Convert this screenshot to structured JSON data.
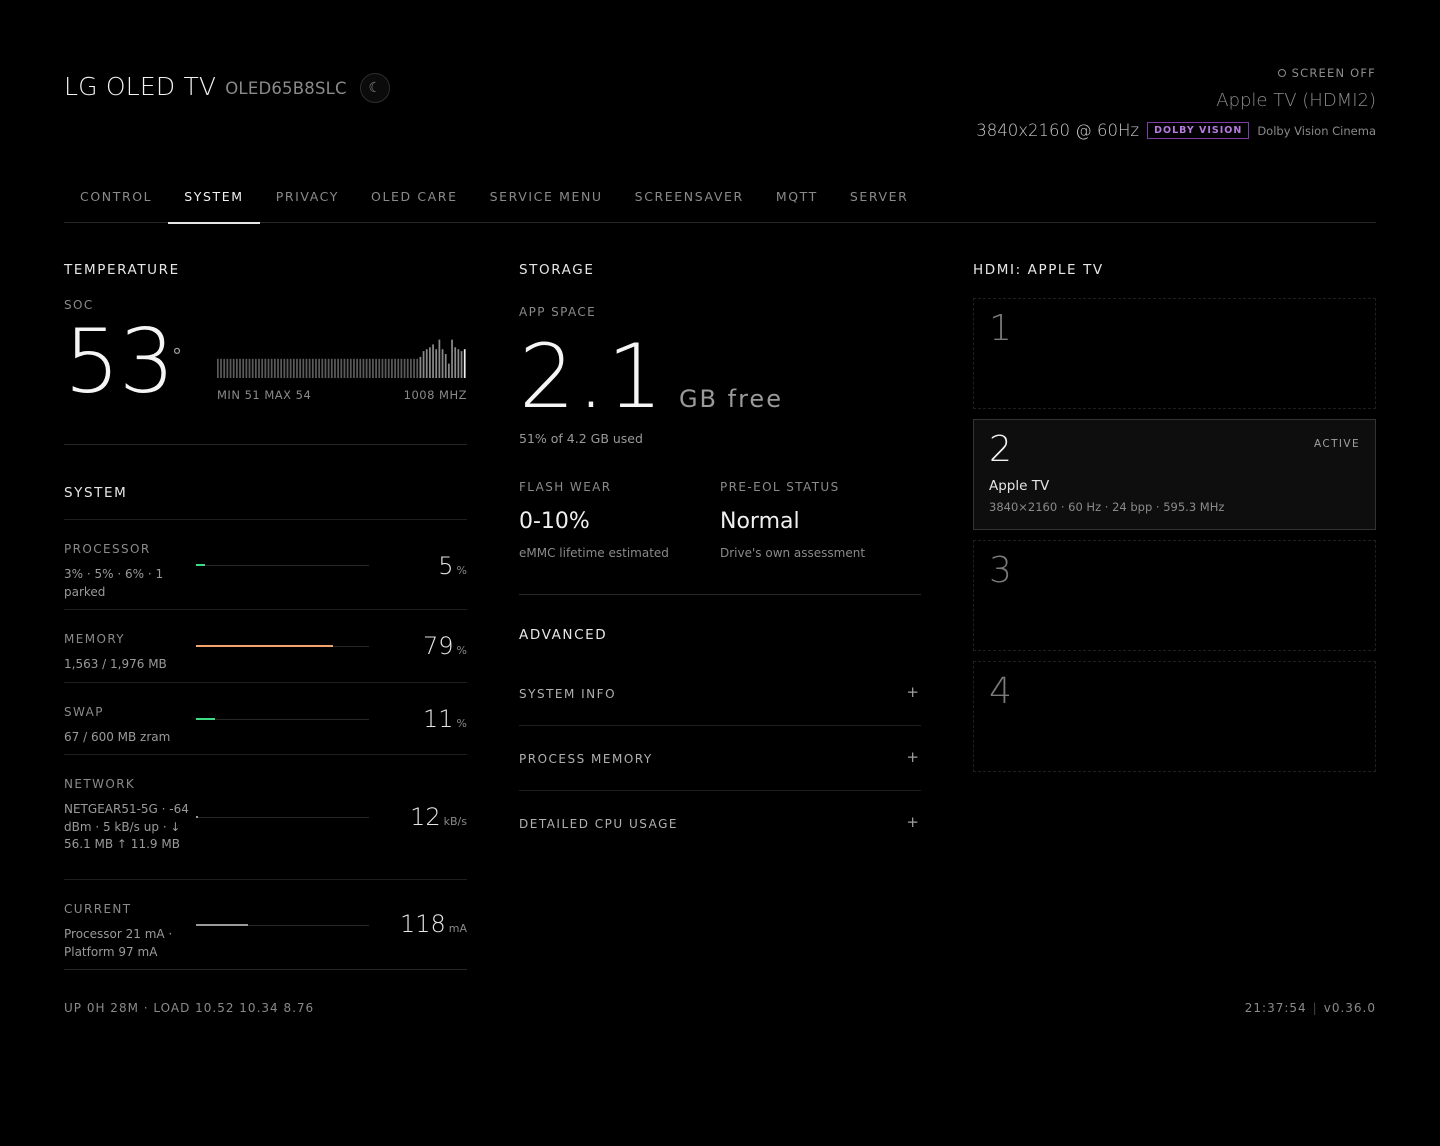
{
  "header": {
    "title": "LG OLED TV",
    "model": "OLED65B8SLC",
    "theme_icon": "moon-icon",
    "screen_off_label": "SCREEN OFF",
    "input_name": "Apple TV (HDMI2)",
    "resolution": "3840x2160 @ 60Hz",
    "hdr_badge": "DOLBY VISION",
    "picture_mode": "Dolby Vision Cinema"
  },
  "tabs": [
    {
      "label": "CONTROL",
      "active": false
    },
    {
      "label": "SYSTEM",
      "active": true
    },
    {
      "label": "PRIVACY",
      "active": false
    },
    {
      "label": "OLED CARE",
      "active": false
    },
    {
      "label": "SERVICE MENU",
      "active": false
    },
    {
      "label": "SCREENSAVER",
      "active": false
    },
    {
      "label": "MQTT",
      "active": false
    },
    {
      "label": "SERVER",
      "active": false
    }
  ],
  "temperature": {
    "title": "TEMPERATURE",
    "sensor_label": "SOC",
    "value": "53",
    "degree": "°",
    "min_max": "MIN 51 MAX 54",
    "frequency": "1008 MHZ",
    "history_scale": [
      50,
      55
    ],
    "history": [
      52,
      52,
      52,
      52,
      52,
      52,
      52,
      52,
      52,
      52,
      52,
      52,
      52,
      52,
      52,
      52,
      52,
      52,
      52,
      52,
      52,
      52,
      52,
      52,
      52,
      52,
      52,
      52,
      52,
      52,
      52,
      52,
      52,
      52,
      52,
      52,
      52,
      52,
      52,
      52,
      52,
      52,
      52,
      52,
      52,
      52,
      52,
      52,
      52,
      52,
      52,
      52,
      52,
      52,
      52,
      52,
      52,
      52,
      52,
      52,
      52,
      52,
      52,
      52,
      52.2,
      52.8,
      53,
      53.2,
      53.5,
      53,
      54,
      53,
      52.5,
      51.5,
      54,
      53.2,
      53,
      52.8,
      53
    ]
  },
  "system": {
    "title": "SYSTEM",
    "rows": [
      {
        "label": "PROCESSOR",
        "desc": "3% · 5% · 6% · 1 parked",
        "value": "5",
        "unit": "%",
        "fill_pct": 5,
        "color": "#3ddc84"
      },
      {
        "label": "MEMORY",
        "desc": "1,563 / 1,976 MB",
        "value": "79",
        "unit": "%",
        "fill_pct": 79,
        "color": "#f5a36c"
      },
      {
        "label": "SWAP",
        "desc": "67 / 600 MB zram",
        "value": "11",
        "unit": "%",
        "fill_pct": 11,
        "color": "#3ddc84"
      },
      {
        "label": "NETWORK",
        "desc": "NETGEAR51-5G · -64 dBm · 5 kB/s up · ↓ 56.1 MB ↑ 11.9 MB",
        "value": "12",
        "unit": "kB/s",
        "fill_pct": 0.5,
        "color": "#9a9a9a"
      },
      {
        "label": "CURRENT",
        "desc": "Processor 21 mA · Platform 97 mA",
        "value": "118",
        "unit": "mA",
        "fill_pct": 30,
        "color": "#9a9a9a"
      }
    ]
  },
  "storage": {
    "title": "STORAGE",
    "sub_label": "APP SPACE",
    "free_value": "2.1",
    "free_unit": "GB free",
    "used_text": "51% of 4.2 GB used",
    "stats": [
      {
        "label": "FLASH WEAR",
        "value": "0-10%",
        "note": "eMMC lifetime estimated"
      },
      {
        "label": "PRE-EOL STATUS",
        "value": "Normal",
        "note": "Drive's own assessment"
      }
    ]
  },
  "advanced": {
    "title": "ADVANCED",
    "items": [
      "SYSTEM INFO",
      "PROCESS MEMORY",
      "DETAILED CPU USAGE"
    ],
    "expand_symbol": "+"
  },
  "hdmi": {
    "title": "HDMI: APPLE TV",
    "slots": [
      {
        "number": "1",
        "active": false
      },
      {
        "number": "2",
        "active": true,
        "badge": "ACTIVE",
        "name": "Apple TV",
        "spec": "3840×2160 · 60 Hz · 24 bpp · 595.3 MHz"
      },
      {
        "number": "3",
        "active": false
      },
      {
        "number": "4",
        "active": false
      }
    ]
  },
  "footer": {
    "uptime": "UP 0H 28M · LOAD 10.52 10.34 8.76",
    "time": "21:37:54",
    "separator": "|",
    "version": "v0.36.0"
  }
}
